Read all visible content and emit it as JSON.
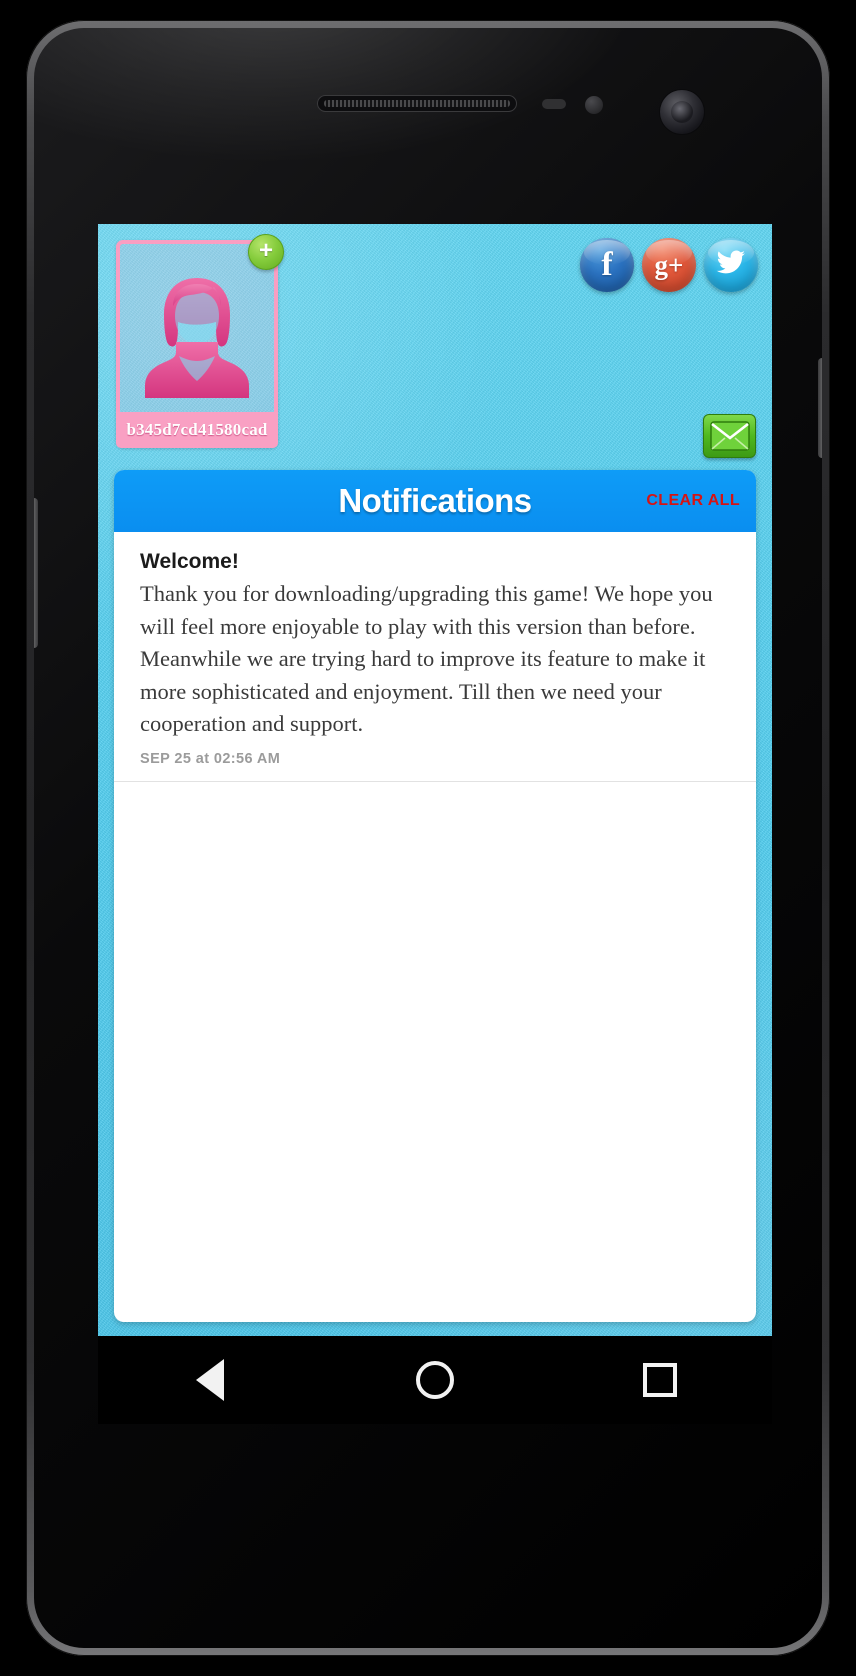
{
  "device": {
    "type": "android-phone",
    "hardware": {
      "earpiece": "speaker-grill",
      "proximity_sensor": "sensor",
      "light_sensor": "sensor",
      "front_camera": "front-camera"
    }
  },
  "screen": {
    "background_color": "#4fcdef"
  },
  "profile": {
    "username": "b345d7cd41580cad",
    "avatar_icon": "female-user-avatar",
    "add_button_label": "+",
    "add_button_icon": "plus-icon",
    "frame_color": "#f99ec2",
    "name_bar_color": "#f9a0c3"
  },
  "social": {
    "buttons": [
      {
        "name": "facebook",
        "glyph": "f",
        "color": "#2b72c0",
        "icon": "facebook-icon"
      },
      {
        "name": "google-plus",
        "glyph": "g+",
        "color": "#e0573a",
        "icon": "google-plus-icon"
      },
      {
        "name": "twitter",
        "glyph": "✦",
        "color": "#2bb6e8",
        "icon": "twitter-icon"
      }
    ]
  },
  "mail": {
    "icon": "envelope-icon",
    "color": "#4fb81f"
  },
  "notifications": {
    "title": "Notifications",
    "clear_all_label": "CLEAR ALL",
    "clear_all_color": "#d61414",
    "header_color": "#0a8ef0",
    "items": [
      {
        "title": "Welcome!",
        "body": "Thank you for downloading/upgrading this game! We hope you will feel more enjoyable to play with this version than before. Meanwhile we are trying hard to improve its feature to make it more sophisticated and enjoyment. Till then we need your cooperation and support.",
        "time": "SEP 25 at 02:56 AM"
      }
    ]
  },
  "navbar": {
    "back_icon": "back-triangle-icon",
    "home_icon": "home-circle-icon",
    "recents_icon": "recents-square-icon"
  }
}
